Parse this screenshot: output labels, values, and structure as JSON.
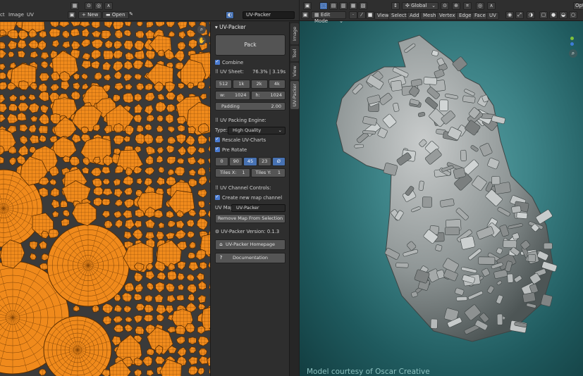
{
  "uv_header": {
    "menu_select": "ct",
    "menu_image": "Image",
    "menu_uv": "UV",
    "new_label": "New",
    "open_label": "Open",
    "image_name": "UV-Packer"
  },
  "panel": {
    "title": "UV-Packer",
    "pack_label": "Pack",
    "combine_label": "Combine",
    "uv_sheet_label": "UV Sheet:",
    "uv_sheet_stats": "76.3% | 3.19s",
    "resolutions": [
      "512",
      "1k",
      "2k",
      "4k"
    ],
    "width_label": "w:",
    "width_value": "1024",
    "height_label": "h:",
    "height_value": "1024",
    "padding_label": "Padding",
    "padding_value": "2.00",
    "engine_label": "UV Packing Engine:",
    "type_label": "Type:",
    "type_value": "High Quality",
    "rescale_label": "Rescale UV-Charts",
    "prerotate_label": "Pre Rotate",
    "rotations": [
      "0",
      "90",
      "45",
      "23",
      "Ø"
    ],
    "selected_rotation_index": 2,
    "tiles_x_label": "Tiles X:",
    "tiles_x_value": "1",
    "tiles_y_label": "Tiles Y:",
    "tiles_y_value": "1",
    "channel_label": "UV Channel Controls:",
    "create_map_label": "Create new map channel",
    "uv_map_label": "UV Map",
    "uv_map_value": "UV-Packer",
    "remove_map_label": "Remove Map From Selection",
    "version_label": "UV-Packer Version: 0.1.3",
    "homepage_label": "UV-Packer Homepage",
    "documentation_label": "Documentation"
  },
  "tabs": [
    "Image",
    "Tool",
    "View",
    "UV-Packer"
  ],
  "viewport": {
    "mode_label": "Edit Mode",
    "menus": [
      "View",
      "Select",
      "Add",
      "Mesh",
      "Vertex",
      "Edge",
      "Face",
      "UV"
    ],
    "orientation_label": "Global",
    "options_label": "Opti",
    "credit": "Model courtesy of Oscar Creative"
  },
  "colors": {
    "uv_island": "#f08a1c",
    "uv_wire": "#7a3f05",
    "uv_background": "#3a3a3a",
    "accent": "#4772b3",
    "viewport_bg": "#3d8387"
  }
}
